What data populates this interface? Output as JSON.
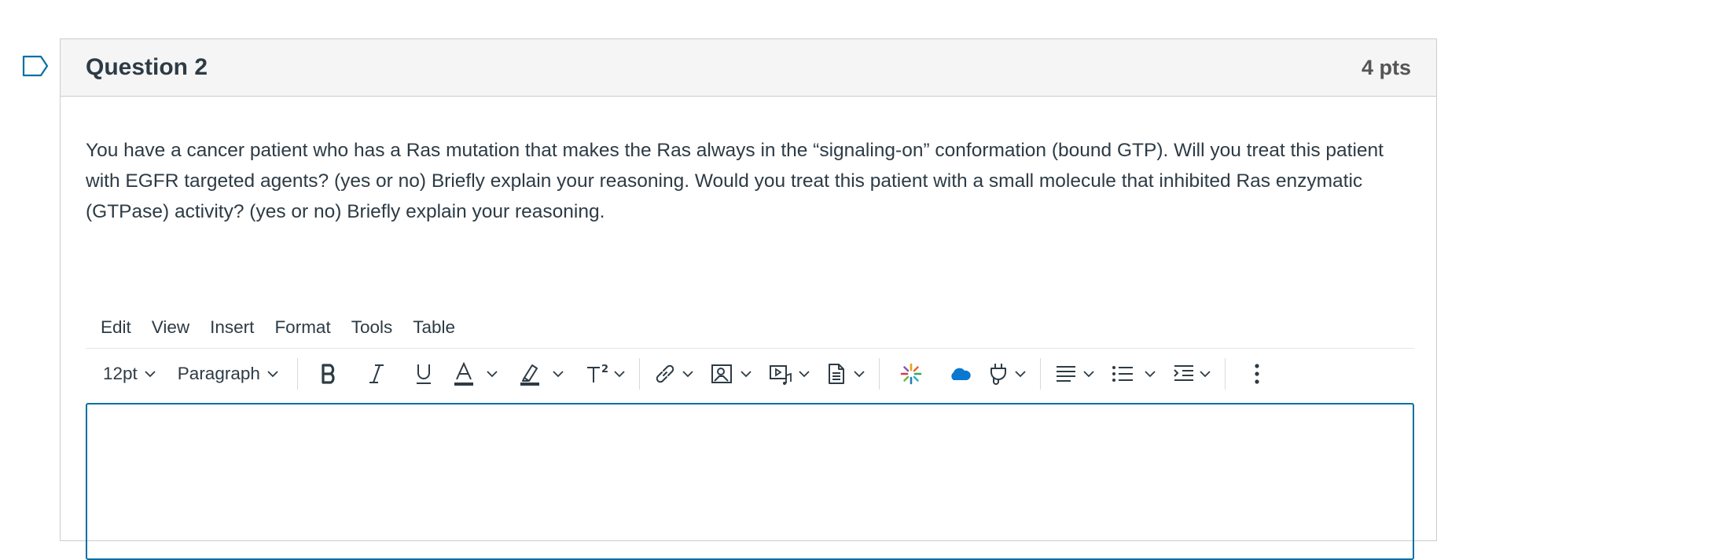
{
  "question": {
    "title": "Question 2",
    "points": "4 pts",
    "text": "You have a cancer patient who has a Ras mutation that makes the Ras always in the “signaling-on” conformation (bound GTP). Will you treat this patient with EGFR targeted agents? (yes or no) Briefly explain your reasoning. Would you treat this patient with a small molecule that inhibited Ras enzymatic (GTPase) activity? (yes or no) Briefly explain your reasoning."
  },
  "menubar": {
    "items": [
      "Edit",
      "View",
      "Insert",
      "Format",
      "Tools",
      "Table"
    ]
  },
  "toolbar": {
    "font_size": "12pt",
    "block_format": "Paragraph"
  },
  "icons": {
    "flag": "flag-icon",
    "bold": "bold-icon",
    "italic": "italic-icon",
    "underline": "underline-icon",
    "text_color": "text-color-icon",
    "highlight": "highlight-icon",
    "superscript": "superscript-icon",
    "link": "link-icon",
    "image": "image-icon",
    "media": "media-icon",
    "document": "document-icon",
    "apps": "apps-icon",
    "onedrive": "cloud-icon",
    "plugin": "plug-icon",
    "align": "align-icon",
    "list": "list-icon",
    "indent": "indent-icon",
    "more": "more-vertical-icon"
  },
  "colors": {
    "editor_border": "#0770a3",
    "text": "#2d3b45",
    "header_bg": "#f5f5f5",
    "cloud": "#0b78d0"
  }
}
